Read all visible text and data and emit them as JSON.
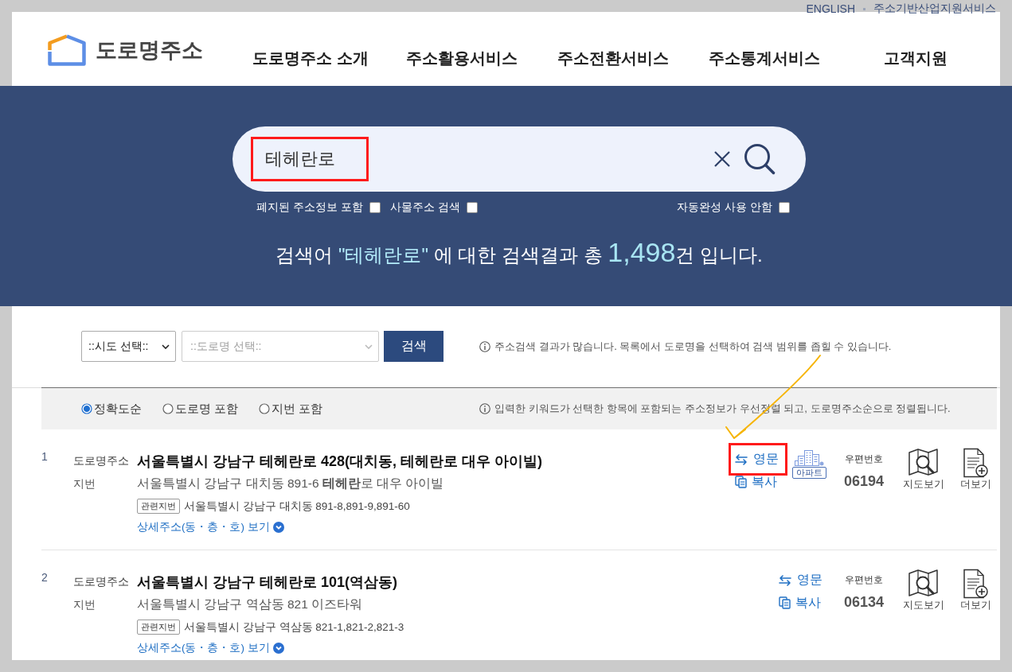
{
  "top_links": [
    {
      "label": "ENGLISH"
    },
    {
      "label": "주소기반산업지원서비스"
    }
  ],
  "logo": {
    "text": "도로명주소"
  },
  "nav": [
    {
      "label": "도로명주소 소개"
    },
    {
      "label": "주소활용서비스"
    },
    {
      "label": "주소전환서비스"
    },
    {
      "label": "주소통계서비스"
    },
    {
      "label": "고객지원"
    }
  ],
  "search": {
    "value": "테헤란로",
    "highlighted": true
  },
  "search_options": [
    {
      "label": "폐지된 주소정보 포함",
      "checked": false
    },
    {
      "label": "사물주소 검색",
      "checked": false
    }
  ],
  "autocomplete_option": {
    "label": "자동완성 사용 안함",
    "checked": false
  },
  "summary": {
    "before": "검색어",
    "keyword": "\"테헤란로\"",
    "middle": "에 대한 검색결과 총",
    "count": "1,498",
    "after": "건 입니다."
  },
  "filters": {
    "region_select": {
      "value": "::시도 선택::",
      "disabled": false
    },
    "road_select": {
      "value": "::도로명 선택::",
      "disabled": true
    },
    "search_button": "검색",
    "notice": "주소검색 결과가 많습니다. 목록에서 도로명을 선택하여 검색 범위를 좁힐 수 있습니다."
  },
  "sort": {
    "options": [
      {
        "label": "정확도순",
        "selected": true
      },
      {
        "label": "도로명 포함",
        "selected": false
      },
      {
        "label": "지번 포함",
        "selected": false
      }
    ],
    "notice": "입력한 키워드가 선택한 항목에 포함되는 주소정보가 우선정렬 되고, 도로명주소순으로 정렬됩니다."
  },
  "results": [
    {
      "number": "1",
      "road_label": "도로명주소",
      "road_address": "서울특별시 강남구 테헤란로 428(대치동, 테헤란로 대우 아이빌)",
      "jibun_label": "지번",
      "jibun_address": "서울특별시 강남구 대치동 891-6 **테헤란**로 대우 아이빌",
      "related_tag": "관련지번",
      "related_address": "서울특별시 강남구 대치동 891-8,891-9,891-60",
      "detail_link": "상세주소(동・층・호) 보기",
      "english": {
        "label": "영문",
        "highlighted": true
      },
      "copy": "복사",
      "building_type": "아파트",
      "postal_label": "우편번호",
      "postal_code": "06194",
      "map_label": "지도보기",
      "more_label": "더보기"
    },
    {
      "number": "2",
      "road_label": "도로명주소",
      "road_address": "서울특별시 강남구 테헤란로 101(역삼동)",
      "jibun_label": "지번",
      "jibun_address": "서울특별시 강남구 역삼동 821 이즈타워",
      "related_tag": "관련지번",
      "related_address": "서울특별시 강남구 역삼동 821-1,821-2,821-3",
      "detail_link": "상세주소(동・층・호) 보기",
      "english": {
        "label": "영문",
        "highlighted": false
      },
      "copy": "복사",
      "postal_label": "우편번호",
      "postal_code": "06134",
      "map_label": "지도보기",
      "more_label": "더보기"
    }
  ]
}
